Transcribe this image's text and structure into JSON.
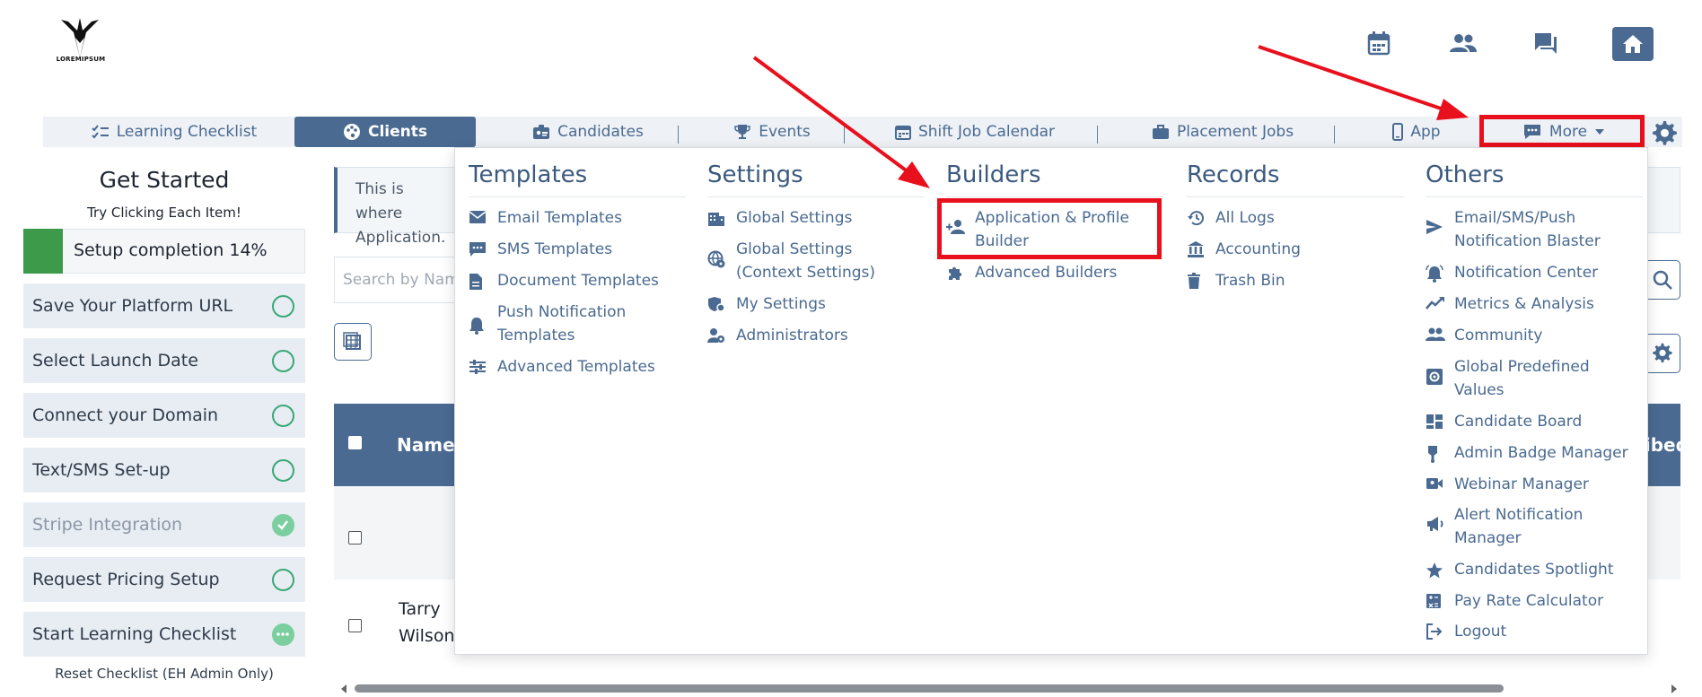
{
  "logo": {
    "text": "LOREMIPSUM"
  },
  "nav": {
    "items": [
      {
        "label": "Learning Checklist",
        "icon": "checklist-icon"
      },
      {
        "label": "Clients",
        "icon": "palette-icon"
      },
      {
        "label": "Candidates",
        "icon": "id-badge-icon"
      },
      {
        "label": "Events",
        "icon": "trophy-icon"
      },
      {
        "label": "Shift Job Calendar",
        "icon": "calendar-icon"
      },
      {
        "label": "Placement Jobs",
        "icon": "briefcase-icon"
      },
      {
        "label": "App",
        "icon": "phone-icon"
      },
      {
        "label": "More",
        "icon": "chat-icon"
      }
    ]
  },
  "sidebar": {
    "title": "Get Started",
    "subtitle": "Try Clicking Each Item!",
    "progress": {
      "label": "Setup completion 14%",
      "percent": 14
    },
    "steps": [
      {
        "label": "Save Your Platform URL",
        "status": "open"
      },
      {
        "label": "Select Launch Date",
        "status": "open"
      },
      {
        "label": "Connect your Domain",
        "status": "open"
      },
      {
        "label": "Text/SMS Set-up",
        "status": "open"
      },
      {
        "label": "Stripe Integration",
        "status": "done"
      },
      {
        "label": "Request Pricing Setup",
        "status": "open"
      },
      {
        "label": "Start Learning Checklist",
        "status": "in-progress"
      }
    ],
    "reset": "Reset Checklist (EH Admin Only)"
  },
  "main": {
    "info_text": "This is where Application.",
    "search_placeholder": "Search by Name",
    "table": {
      "headers": [
        "Name",
        "ribed"
      ],
      "rows": [
        {
          "name": ""
        },
        {
          "name": "Tarry Wilson"
        }
      ]
    }
  },
  "dropdown": {
    "columns": [
      {
        "title": "Templates",
        "items": [
          {
            "label": "Email Templates",
            "icon": "envelope-icon"
          },
          {
            "label": "SMS Templates",
            "icon": "sms-icon"
          },
          {
            "label": "Document Templates",
            "icon": "document-icon"
          },
          {
            "label": "Push Notification Templates",
            "icon": "bell-icon"
          },
          {
            "label": "Advanced Templates",
            "icon": "sliders-icon"
          }
        ]
      },
      {
        "title": "Settings",
        "items": [
          {
            "label": "Global Settings",
            "icon": "building-icon"
          },
          {
            "label": "Global Settings (Context Settings)",
            "icon": "globe-gear-icon"
          },
          {
            "label": "My Settings",
            "icon": "user-shield-icon"
          },
          {
            "label": "Administrators",
            "icon": "user-gear-icon"
          }
        ]
      },
      {
        "title": "Builders",
        "items": [
          {
            "label": "Application & Profile Builder",
            "icon": "person-add-icon"
          },
          {
            "label": "Advanced Builders",
            "icon": "puzzle-icon"
          }
        ]
      },
      {
        "title": "Records",
        "items": [
          {
            "label": "All Logs",
            "icon": "history-icon"
          },
          {
            "label": "Accounting",
            "icon": "bank-icon"
          },
          {
            "label": "Trash Bin",
            "icon": "trash-icon"
          }
        ]
      },
      {
        "title": "Others",
        "items": [
          {
            "label": "Email/SMS/Push Notification Blaster",
            "icon": "send-icon"
          },
          {
            "label": "Notification Center",
            "icon": "bell-ring-icon"
          },
          {
            "label": "Metrics & Analysis",
            "icon": "trend-icon"
          },
          {
            "label": "Community",
            "icon": "people-icon"
          },
          {
            "label": "Global Predefined Values",
            "icon": "gear-box-icon"
          },
          {
            "label": "Candidate Board",
            "icon": "dashboard-icon"
          },
          {
            "label": "Admin Badge Manager",
            "icon": "badge-icon"
          },
          {
            "label": "Webinar Manager",
            "icon": "video-icon"
          },
          {
            "label": "Alert Notification Manager",
            "icon": "megaphone-icon"
          },
          {
            "label": "Candidates Spotlight",
            "icon": "star-icon"
          },
          {
            "label": "Pay Rate Calculator",
            "icon": "calculator-icon"
          },
          {
            "label": "Logout",
            "icon": "logout-icon"
          }
        ]
      }
    ]
  },
  "colors": {
    "primary": "#4a6a91",
    "highlight": "#e8101c",
    "success": "#3d9a4a"
  }
}
